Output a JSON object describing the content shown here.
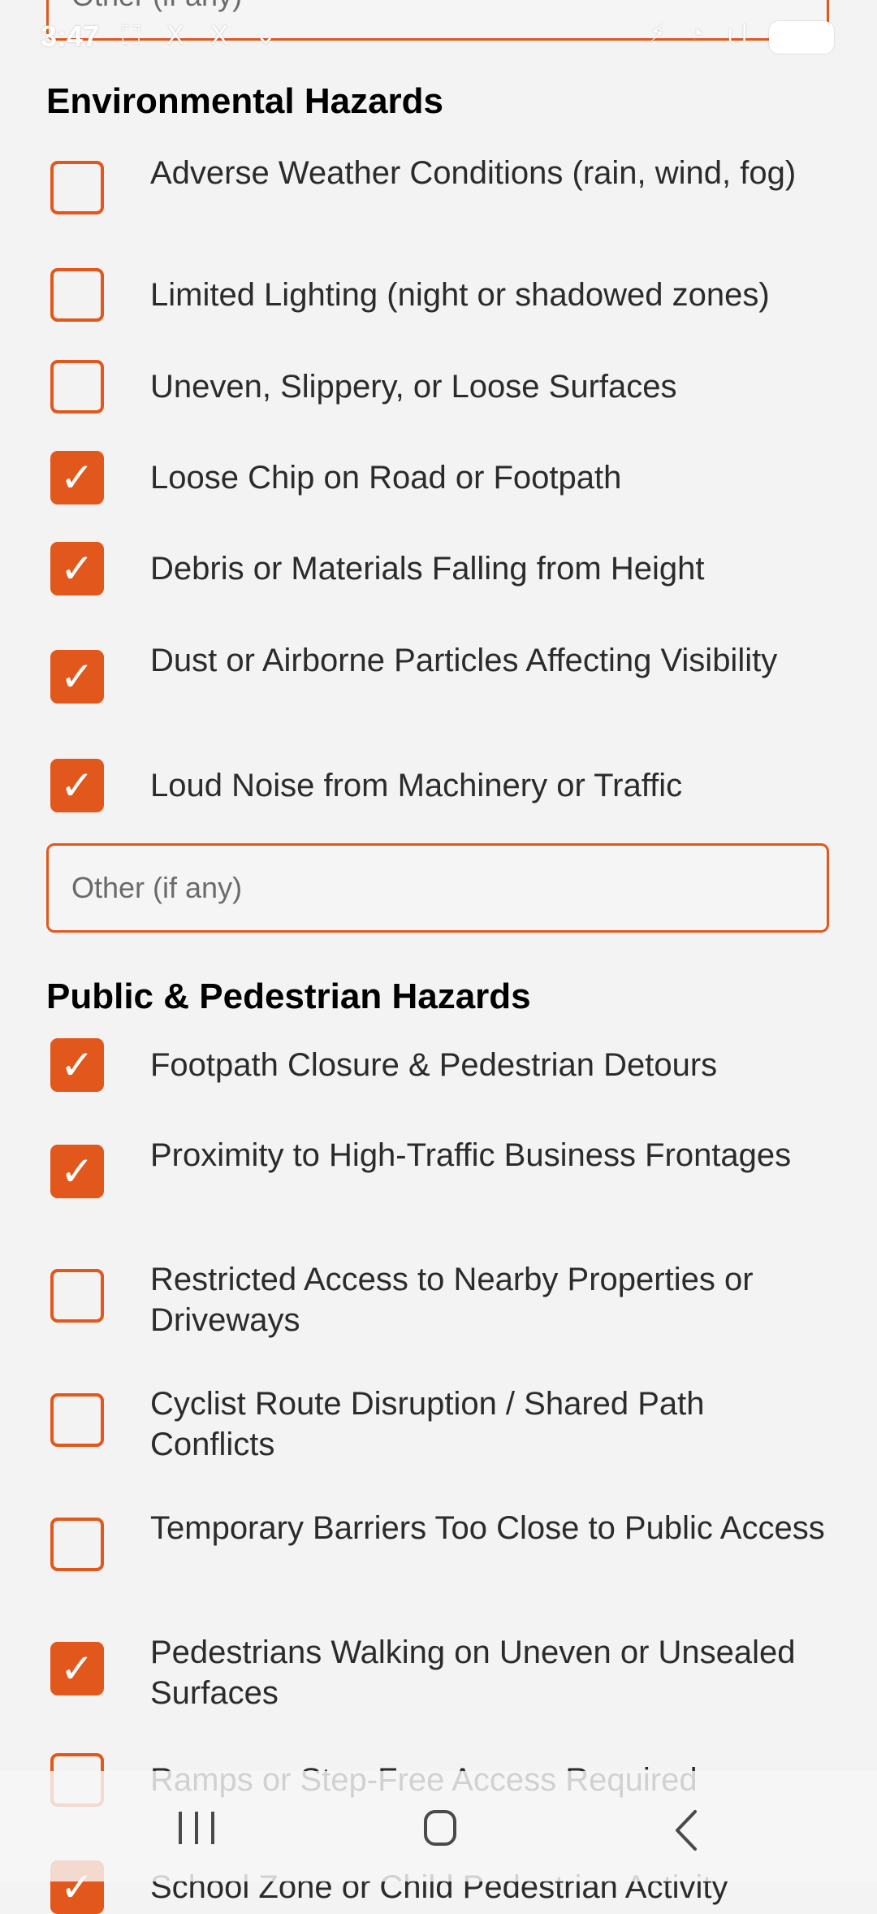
{
  "status_bar": {
    "time": "3:47",
    "left_icons": "⛶ X X ⌄",
    "right_icons": "⚡ ◔ ıl"
  },
  "top_other_field": {
    "placeholder": "Other (if any)"
  },
  "environmental": {
    "title": "Environmental Hazards",
    "items": [
      {
        "label": "Adverse Weather Conditions (rain, wind, fog)",
        "checked": false
      },
      {
        "label": "Limited Lighting (night or shadowed zones)",
        "checked": false
      },
      {
        "label": "Uneven, Slippery, or Loose Surfaces",
        "checked": false
      },
      {
        "label": "Loose Chip on Road or Footpath",
        "checked": true
      },
      {
        "label": "Debris or Materials Falling from Height",
        "checked": true
      },
      {
        "label": "Dust or Airborne Particles Affecting Visibility",
        "checked": true
      },
      {
        "label": "Loud Noise from Machinery or Traffic",
        "checked": true
      }
    ],
    "other_placeholder": "Other (if any)"
  },
  "public": {
    "title": "Public & Pedestrian Hazards",
    "items": [
      {
        "label": "Footpath Closure & Pedestrian Detours",
        "checked": true
      },
      {
        "label": "Proximity to High-Traffic Business Frontages",
        "checked": true
      },
      {
        "label": "Restricted Access to Nearby Properties or Driveways",
        "checked": false
      },
      {
        "label": "Cyclist Route Disruption / Shared Path Conflicts",
        "checked": false
      },
      {
        "label": "Temporary Barriers Too Close to Public Access",
        "checked": false
      },
      {
        "label": "Pedestrians Walking on Uneven or Unsealed Surfaces",
        "checked": true
      },
      {
        "label": "Ramps or Step-Free Access Required",
        "checked": false
      },
      {
        "label": "School Zone or Child Pedestrian Activity",
        "checked": true
      }
    ]
  },
  "colors": {
    "accent": "#e2571b",
    "background": "#f3f3f3"
  },
  "checkmark": "✓"
}
